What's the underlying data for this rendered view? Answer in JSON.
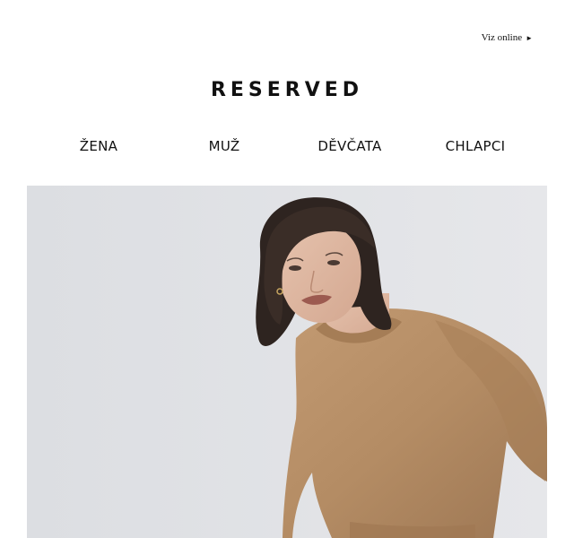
{
  "header": {
    "view_online_label": "Viz online",
    "view_online_arrow": "►"
  },
  "brand": {
    "logo_text": "RESERVED"
  },
  "nav": {
    "items": [
      {
        "label": "ŽENA"
      },
      {
        "label": "MUŽ"
      },
      {
        "label": "DĚVČATA"
      },
      {
        "label": "CHLAPCI"
      }
    ]
  },
  "hero": {
    "image_subject": "model-camel-sweater",
    "background_color": "#e2e4e7",
    "sweater_color": "#b48c64",
    "hair_color": "#2e2420"
  }
}
